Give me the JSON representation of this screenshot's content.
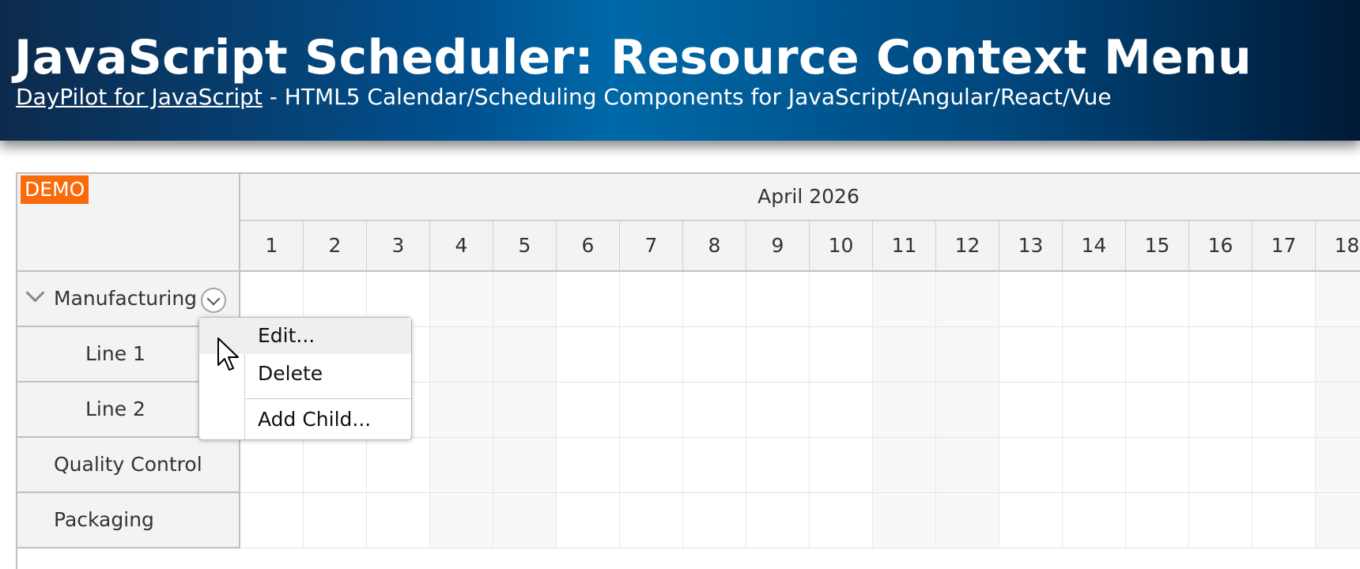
{
  "page": {
    "title": "JavaScript Scheduler: Resource Context Menu",
    "subtitle_link": "DayPilot for JavaScript",
    "subtitle_rest": " - HTML5 Calendar/Scheduling Components for JavaScript/Angular/React/Vue"
  },
  "scheduler": {
    "demo_badge": "DEMO",
    "month_label": "April 2026",
    "days": [
      "1",
      "2",
      "3",
      "4",
      "5",
      "6",
      "7",
      "8",
      "9",
      "10",
      "11",
      "12",
      "13",
      "14",
      "15",
      "16",
      "17",
      "18"
    ],
    "resources": [
      {
        "name": "Manufacturing",
        "expandable": true
      },
      {
        "name": "Line 1"
      },
      {
        "name": "Line 2"
      },
      {
        "name": "Quality Control"
      },
      {
        "name": "Packaging"
      }
    ]
  },
  "context_menu": {
    "items": [
      "Edit...",
      "Delete",
      "Add Child..."
    ],
    "hovered_item": "Edit..."
  },
  "icons": {
    "expand": "chevron-down-icon",
    "resource_menu": "chevron-circle-down-icon",
    "cursor": "mouse-pointer-icon"
  },
  "colors": {
    "header_gradient_mid": "#0069a8",
    "demo_badge": "#f96a0a",
    "grid_header": "#f3f3f3"
  }
}
